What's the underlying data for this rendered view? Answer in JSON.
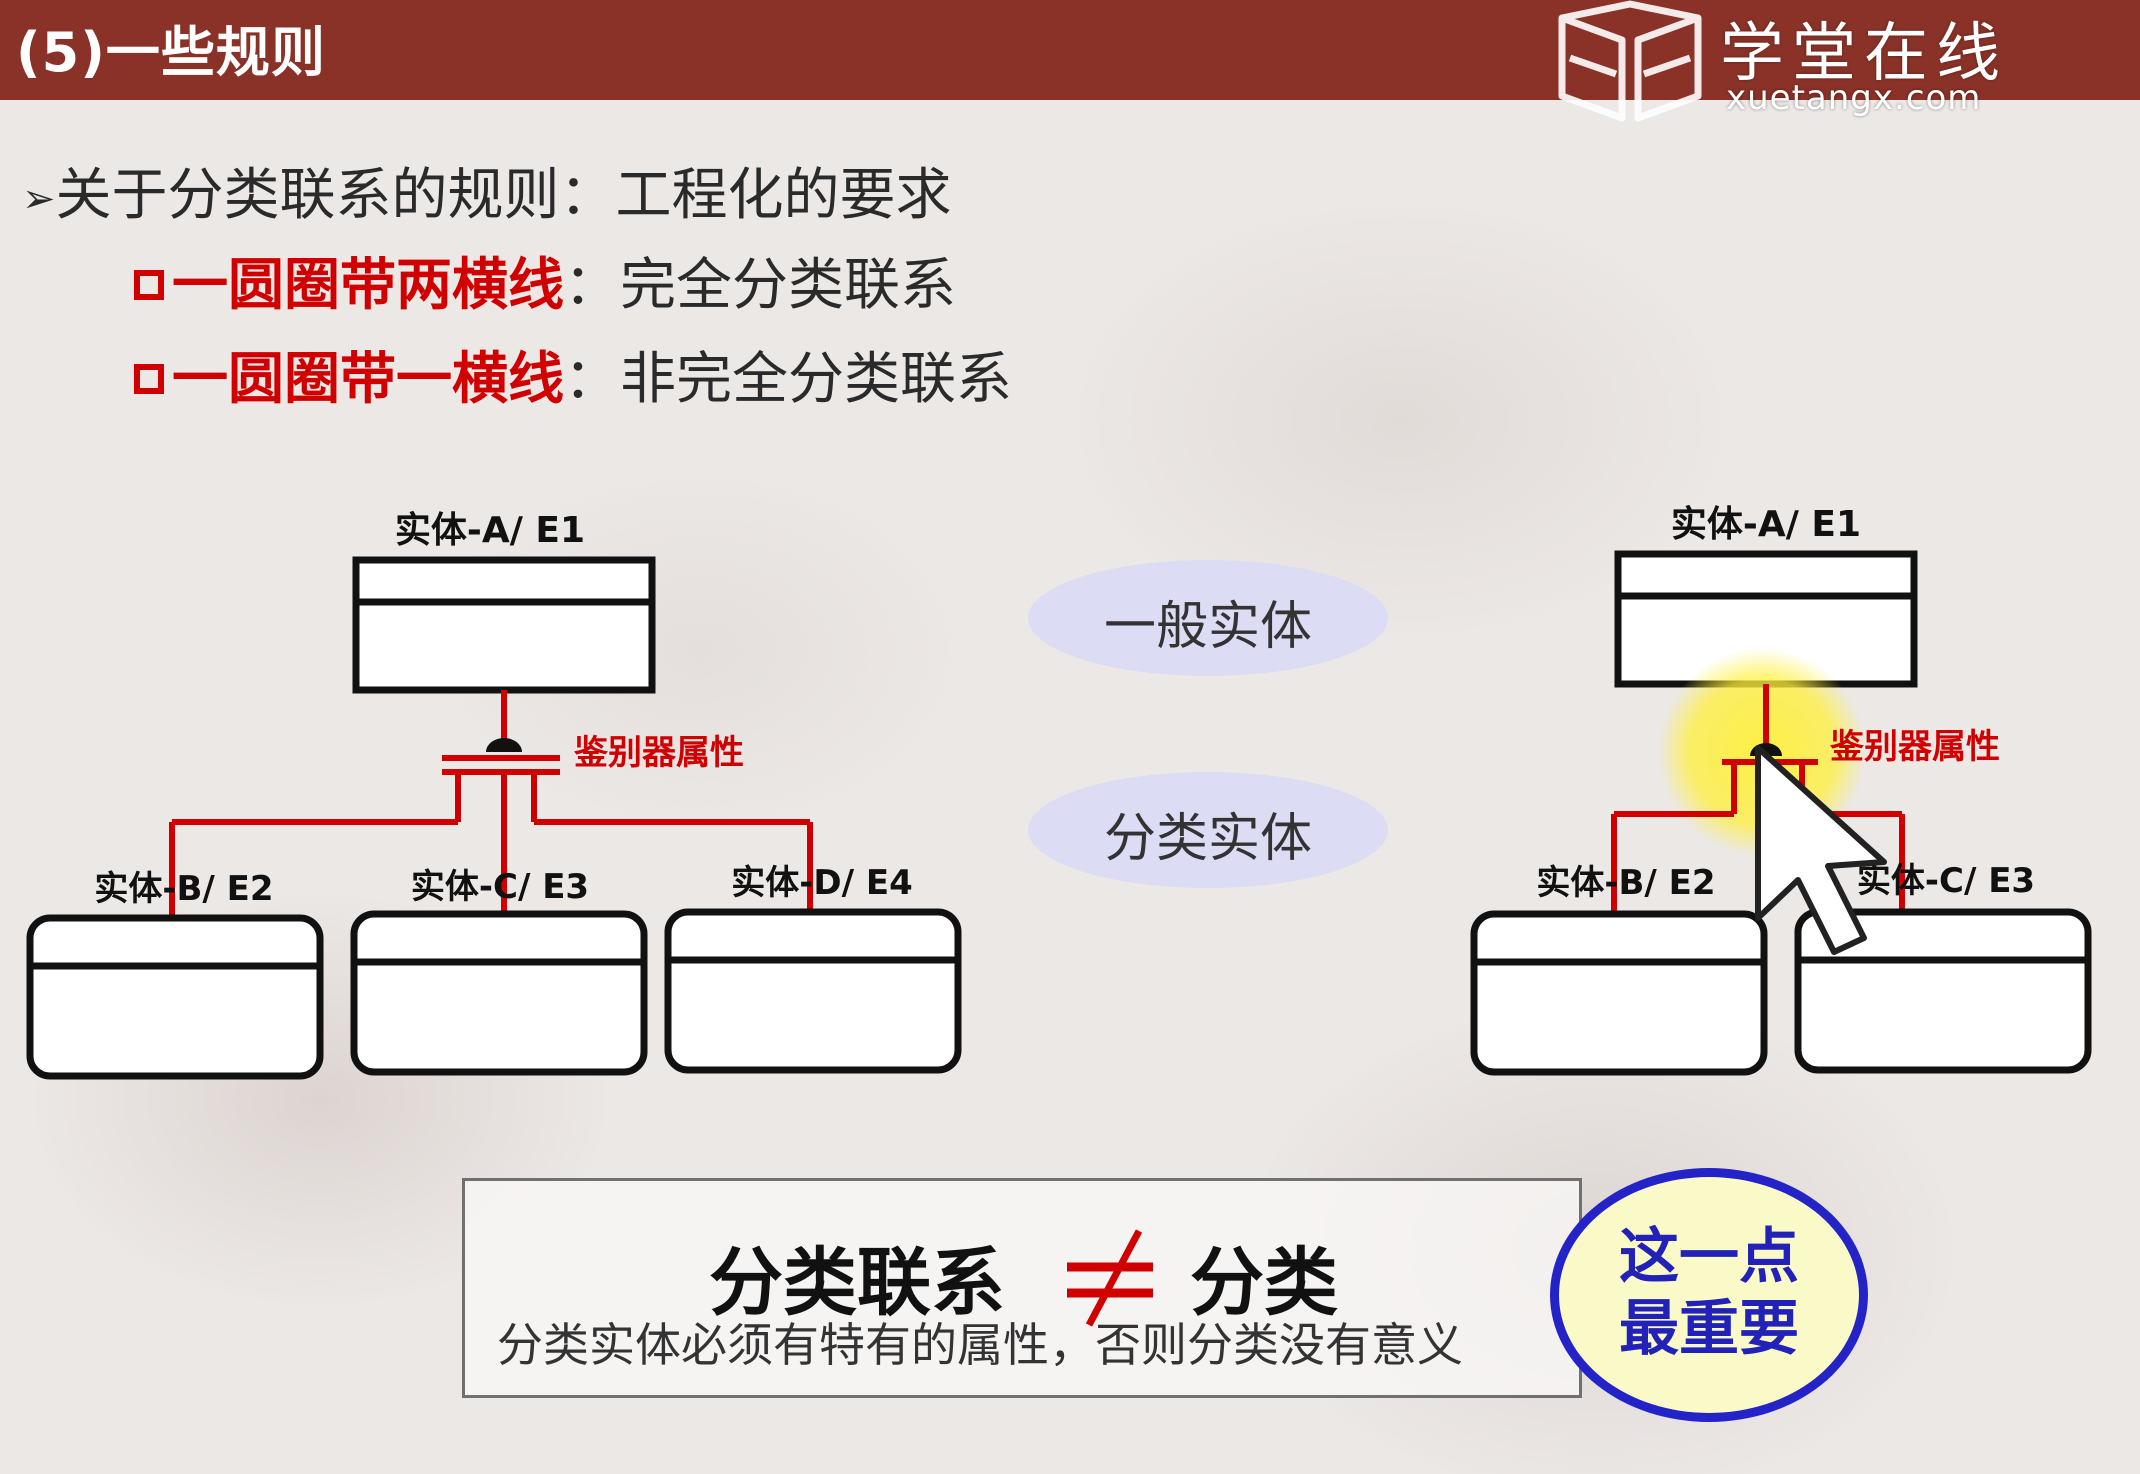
{
  "header": {
    "title": "(5)一些规则",
    "brand_name": "学堂在线",
    "brand_url": "xuetangx.com"
  },
  "content": {
    "bullet": "关于分类联系的规则：工程化的要求",
    "rules": [
      {
        "emphasis": "一圆圈带两横线",
        "meaning": "：完全分类联系"
      },
      {
        "emphasis": "一圆圈带一横线",
        "meaning": "：非完全分类联系"
      }
    ]
  },
  "diagram_left": {
    "parent": "实体-A/ E1",
    "discriminator": "鉴别器属性",
    "children": [
      "实体-B/ E2",
      "实体-C/ E3",
      "实体-D/ E4"
    ]
  },
  "diagram_right": {
    "parent": "实体-A/ E1",
    "discriminator": "鉴别器属性",
    "children": [
      "实体-B/ E2",
      "实体-C/ E3"
    ]
  },
  "legend": {
    "general": "一般实体",
    "category": "分类实体"
  },
  "note": {
    "left": "分类联系",
    "right": "分类",
    "sub": "分类实体必须有特有的属性，否则分类没有意义"
  },
  "badge": {
    "line1": "这一点",
    "line2": "最重要"
  },
  "colors": {
    "header": "#8a3227",
    "relation_red": "#d00000",
    "ellipse_fill": "#dcdcf5",
    "badge_border": "#2323c8",
    "badge_fill": "#fafac8",
    "cursor_highlight": "#fff03c"
  }
}
